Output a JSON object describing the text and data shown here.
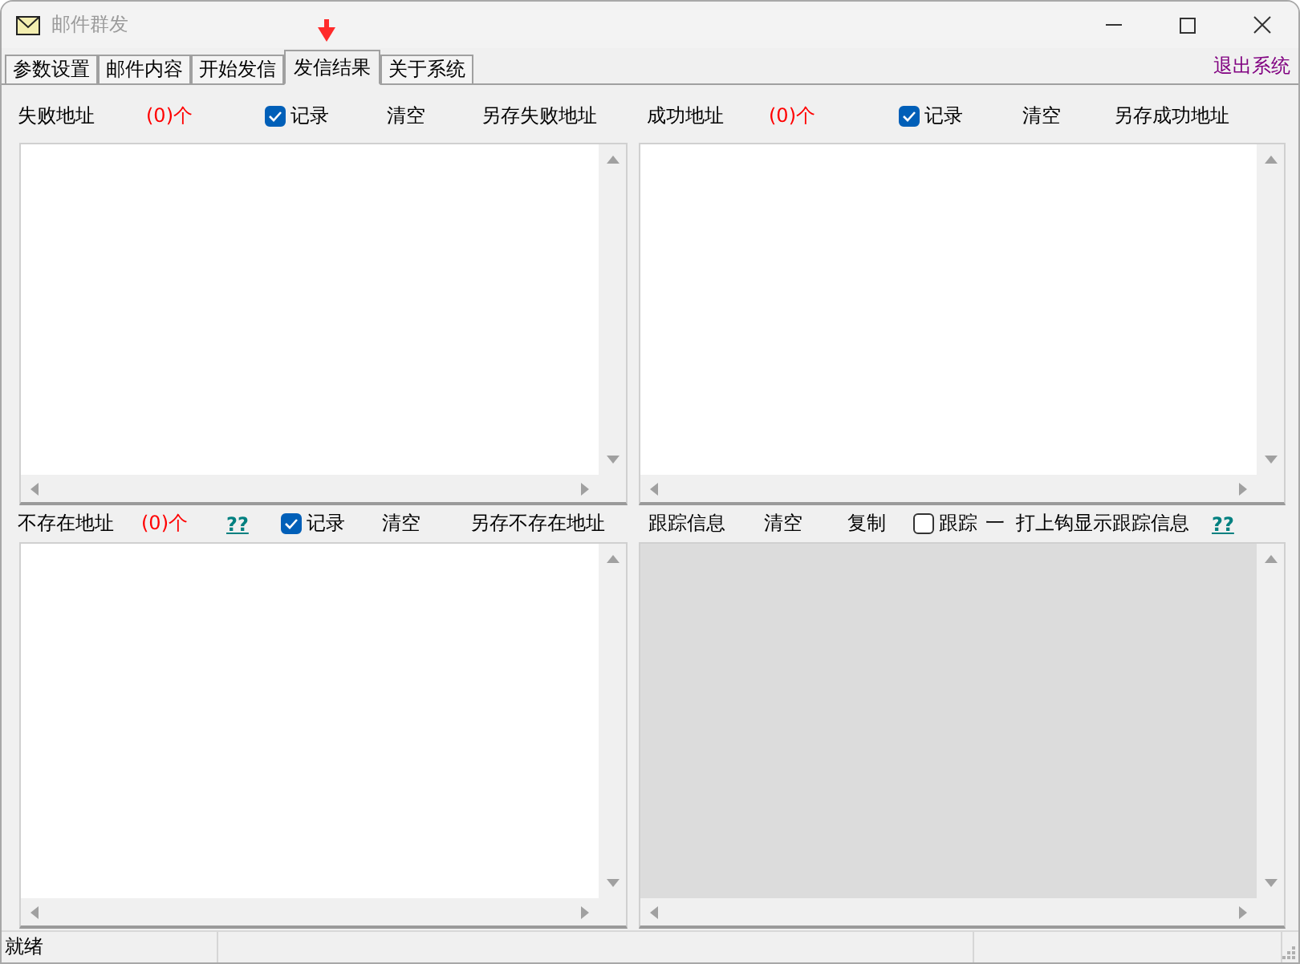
{
  "window": {
    "title": "邮件群发"
  },
  "tabs": [
    {
      "label": "参数设置",
      "selected": false
    },
    {
      "label": "邮件内容",
      "selected": false
    },
    {
      "label": "开始发信",
      "selected": false
    },
    {
      "label": "发信结果",
      "selected": true
    },
    {
      "label": "关于系统",
      "selected": false
    }
  ],
  "exit_link": "退出系统",
  "panels": [
    {
      "kind": "address",
      "title": "失败地址",
      "count": "(0)个",
      "record": {
        "label": "记录",
        "checked": true
      },
      "clear": "清空",
      "save": "另存失败地址",
      "list_disabled": false
    },
    {
      "kind": "address",
      "title": "成功地址",
      "count": "(0)个",
      "record": {
        "label": "记录",
        "checked": true
      },
      "clear": "清空",
      "save": "另存成功地址",
      "list_disabled": false
    },
    {
      "kind": "address",
      "title": "不存在地址",
      "count": "(0)个",
      "help": "??",
      "record": {
        "label": "记录",
        "checked": true
      },
      "clear": "清空",
      "save": "另存不存在地址",
      "list_disabled": false
    },
    {
      "kind": "trace",
      "title": "跟踪信息",
      "clear": "清空",
      "copy": "复制",
      "trace": {
        "label": "跟踪",
        "checked": false
      },
      "dash": "一",
      "hint": "打上钩显示跟踪信息",
      "help": "??",
      "list_disabled": true
    }
  ],
  "status_bar": {
    "text": "就绪"
  }
}
